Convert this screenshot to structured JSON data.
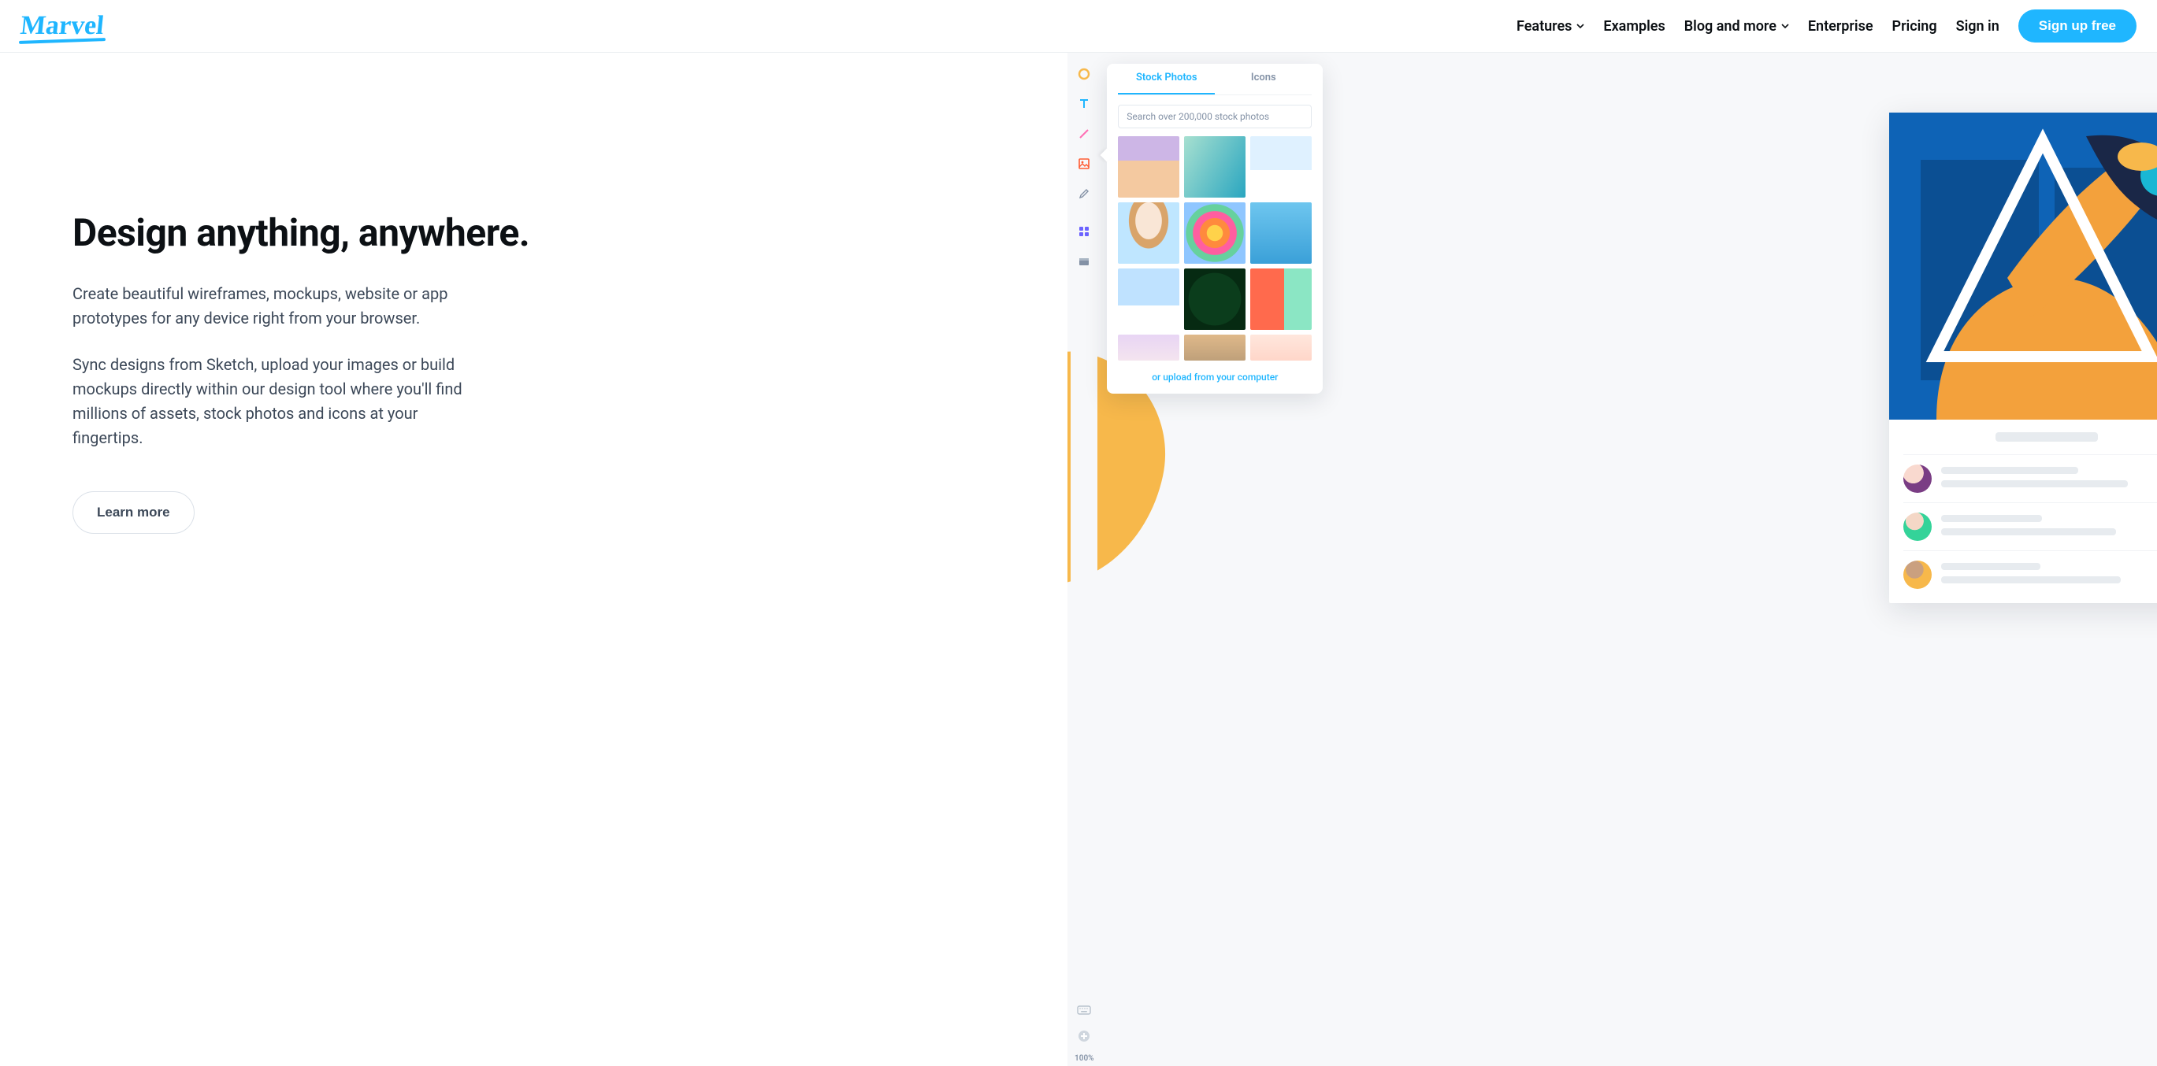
{
  "brand": "Marvel",
  "nav": {
    "features": "Features",
    "examples": "Examples",
    "blog": "Blog and more",
    "enterprise": "Enterprise",
    "pricing": "Pricing",
    "signin": "Sign in",
    "signup": "Sign up free"
  },
  "hero": {
    "headline": "Design anything, anywhere.",
    "para1": "Create beautiful wireframes, mockups, website or app prototypes for any device right from your browser.",
    "para2": "Sync designs from Sketch, upload your images or build mockups directly within our design tool where you'll find millions of assets, stock photos and icons at your fingertips.",
    "cta": "Learn more"
  },
  "tools": {
    "shape": "shape-icon",
    "text": "text-icon",
    "line": "line-icon",
    "image": "image-icon",
    "pencil": "pencil-icon",
    "components": "components-icon",
    "archive": "archive-icon",
    "keyboard": "keyboard-icon",
    "add": "add-icon",
    "zoom": "100%"
  },
  "popover": {
    "tab_stock": "Stock Photos",
    "tab_icons": "Icons",
    "search_placeholder": "Search over 200,000 stock photos",
    "upload": "or upload from your computer"
  },
  "colors": {
    "accent": "#1fb6ff",
    "orange": "#f7b84b"
  }
}
